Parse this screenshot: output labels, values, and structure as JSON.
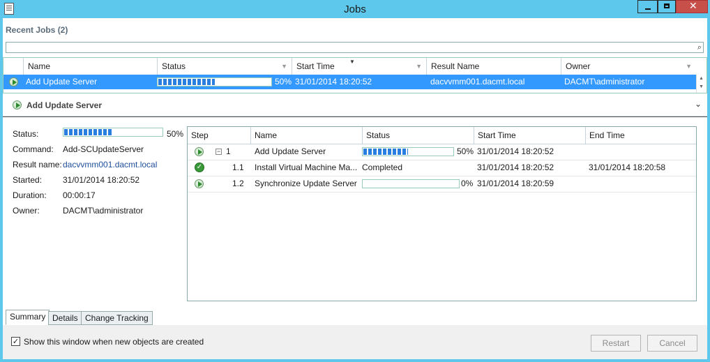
{
  "window": {
    "title": "Jobs"
  },
  "recent": {
    "title": "Recent Jobs (2)"
  },
  "search": {
    "value": "",
    "placeholder": ""
  },
  "grid": {
    "columns": [
      "Name",
      "Status",
      "Start Time",
      "Result Name",
      "Owner"
    ],
    "rows": [
      {
        "name": "Add Update Server",
        "progress": 50,
        "progress_text": "50%",
        "start_time": "31/01/2014 18:20:52",
        "result_name": "dacvvmm001.dacmt.local",
        "owner": "DACMT\\administrator"
      }
    ]
  },
  "detail": {
    "header": "Add Update Server",
    "labels": {
      "status": "Status:",
      "command": "Command:",
      "result_name": "Result name:",
      "started": "Started:",
      "duration": "Duration:",
      "owner": "Owner:"
    },
    "values": {
      "progress": 50,
      "progress_text": "50%",
      "command": "Add-SCUpdateServer",
      "result_name": "dacvvmm001.dacmt.local",
      "started": "31/01/2014 18:20:52",
      "duration": "00:00:17",
      "owner": "DACMT\\administrator"
    }
  },
  "steps": {
    "columns": [
      "Step",
      "Name",
      "Status",
      "Start Time",
      "End Time"
    ],
    "rows": [
      {
        "step": "1",
        "name": "Add Update Server",
        "status_type": "progress",
        "progress": 50,
        "progress_text": "50%",
        "start": "31/01/2014 18:20:52",
        "end": "",
        "icon": "play-icon"
      },
      {
        "step": "1.1",
        "name": "Install Virtual Machine Ma...",
        "status_type": "text",
        "status": "Completed",
        "start": "31/01/2014 18:20:52",
        "end": "31/01/2014 18:20:58",
        "icon": "check-icon"
      },
      {
        "step": "1.2",
        "name": "Synchronize Update Server",
        "status_type": "progress",
        "progress": 0,
        "progress_text": "0%",
        "start": "31/01/2014 18:20:59",
        "end": "",
        "icon": "play-icon"
      }
    ]
  },
  "tabs": [
    "Summary",
    "Details",
    "Change Tracking"
  ],
  "footer": {
    "checkbox_label": "Show this window when new objects are created",
    "checkbox_checked": true,
    "restart": "Restart",
    "cancel": "Cancel"
  },
  "colors": {
    "titlebar": "#5ec8ec",
    "selection": "#3399ff",
    "progress": "#2a7ee0",
    "close": "#c7504a"
  }
}
